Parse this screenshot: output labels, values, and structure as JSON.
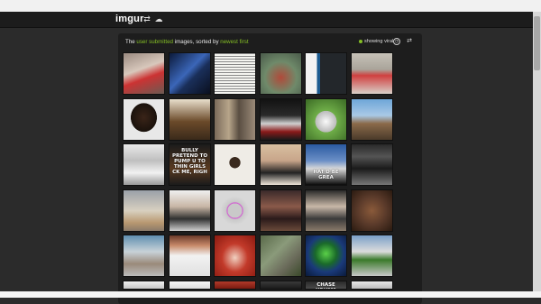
{
  "header": {
    "logo": "imgur",
    "random_icon": "shuffle-icon",
    "upload_icon": "cloud-upload-icon"
  },
  "gallery": {
    "caption_prefix": "The ",
    "caption_link1": "user submitted",
    "caption_middle": " images, sorted by ",
    "caption_link2": "newest first",
    "viral_label": "showing viral",
    "viral_dot_color": "#85bf25",
    "sort_icon": "clock-icon",
    "shuffle_icon": "shuffle-icon"
  },
  "tiles": [
    {
      "caption": "",
      "bg": "linear-gradient(160deg,#9a8a80,#d8c8bc 40%,#c33 60%,#6b5a52)"
    },
    {
      "caption": "",
      "bg": "linear-gradient(135deg,#0b1a3a,#3b66b8 45%,#1a2f5a 60%,#0a0f1e)"
    },
    {
      "caption": "",
      "bg": "repeating-linear-gradient(0deg,#f4f4f0 0,#f4f4f0 2px,#888 2px,#888 3px)"
    },
    {
      "caption": "",
      "bg": "radial-gradient(circle at 50% 60%,#b04a3a,#6f8a6a 50%,#4a5a4a)"
    },
    {
      "caption": "",
      "bg": "linear-gradient(90deg,#f2f2f2 0,#f2f2f2 28%,#1b5a8f 28%,#1b5a8f 36%,#23272b 36%)"
    },
    {
      "caption": "",
      "bg": "linear-gradient(180deg,#c7c2b8,#a9a49a 40%,#d04040 55%,#d8d0c8)"
    },
    {
      "caption": "",
      "bg": "radial-gradient(ellipse at 50% 45%,#3a2418,#1a120c 45%,#e8e8e8 46%)"
    },
    {
      "caption": "",
      "bg": "linear-gradient(180deg,#e9dfcc,#6b4a2a 55%,#3a2a1a)"
    },
    {
      "caption": "",
      "bg": "linear-gradient(90deg,#7a6a5a,#b7a58a 35%,#5a4e42 60%,#9a8a78)"
    },
    {
      "caption": "",
      "bg": "linear-gradient(180deg,#121212,#2a2a2a 40%,#d0d0d0 60%,#8a1a1a 80%,#1a1a1a)"
    },
    {
      "caption": "",
      "bg": "radial-gradient(circle at 50% 55%,#fafafa,#bbb 35%,#6fae48 36%,#3b6a25)"
    },
    {
      "caption": "",
      "bg": "linear-gradient(180deg,#6ea6d8,#a9c9e6 40%,#8b6a4a 60%,#4a3a2a)"
    },
    {
      "caption": "",
      "bg": "linear-gradient(180deg,#e9e9e9,#bfbfbf 40%,#f2f2f2 70%,#999)"
    },
    {
      "caption": "BULLY PRETEND TO PUMP U TO THIN GIRLS CK ME, RIGH",
      "bg": "linear-gradient(180deg,#1b1b1b,#5a3a20 60%,#1b1b1b)"
    },
    {
      "caption": "",
      "bg": "radial-gradient(circle at 50% 45%,#3a2a1e 0,#3a2a1e 18%,#efece6 19%)"
    },
    {
      "caption": "",
      "bg": "linear-gradient(180deg,#d8c0a0,#c8a58a 40%,#222 70%,#efe6da)"
    },
    {
      "caption": "HAT'D BE GREA",
      "bg": "linear-gradient(180deg,#2a5aa0,#6a8ec6 40%,#d8d8d8 60%,#0a0a0a)"
    },
    {
      "caption": "",
      "bg": "linear-gradient(180deg,#2a2a2a,#545454 30%,#1a1a1a 60%,#777)"
    },
    {
      "caption": "",
      "bg": "linear-gradient(180deg,#9aa0a8,#d8d0c0 50%,#b89870 80%,#8a7a6a)"
    },
    {
      "caption": "",
      "bg": "linear-gradient(180deg,#f0f0f0,#c8b6a6 40%,#303030 70%,#d0d0d0)"
    },
    {
      "caption": "",
      "bg": "radial-gradient(circle at 50% 50%,#c9c9c9 0,#c9c9c9 25%,#d34ad2 26%,#c9c9c9 31%,#d8d8d8 50%)"
    },
    {
      "caption": "",
      "bg": "linear-gradient(180deg,#3a2a2a,#8a5a4a 40%,#2a1a1a 70%,#6a4a3a)"
    },
    {
      "caption": "",
      "bg": "linear-gradient(180deg,#2a2a2a,#c8b8a8 40%,#3a3a3a 70%,#8a7a6a)"
    },
    {
      "caption": "",
      "bg": "radial-gradient(circle at 50% 50%,#8a5a3a,#5a3a2a 50%,#2a1a10)"
    },
    {
      "caption": "",
      "bg": "linear-gradient(180deg,#5f8fb0,#c8d2d8 40%,#9a8a7a 70%,#bbb)"
    },
    {
      "caption": "",
      "bg": "linear-gradient(180deg,#6a3a2a,#c88a6a 25%,#f2f2f2 50%,#e0e0e0)"
    },
    {
      "caption": "",
      "bg": "radial-gradient(ellipse at 50% 55%,#f0d0c0,#c23a2a 45%,#8a1a10)"
    },
    {
      "caption": "",
      "bg": "linear-gradient(135deg,#5a6a4a,#8a9a7a 40%,#6a6a5a 70%,#3a4a2a)"
    },
    {
      "caption": "",
      "bg": "radial-gradient(circle at 50% 45%,#5ad048,#1a6a2a 35%,#1a3a7a 60%,#0a1a3a)"
    },
    {
      "caption": "",
      "bg": "linear-gradient(180deg,#7aa0c8,#dcdcdc 40%,#3a7a2a 60%,#c8c8c8)"
    },
    {
      "caption": "",
      "bg": "linear-gradient(180deg,#f0f0f0,#c8c8c8)"
    },
    {
      "caption": "",
      "bg": "linear-gradient(180deg,#f6f6f6,#dcdcdc)"
    },
    {
      "caption": "",
      "bg": "linear-gradient(180deg,#b03a2a,#7a1a10)"
    },
    {
      "caption": "",
      "bg": "linear-gradient(180deg,#3a3a3a,#1a1a1a)"
    },
    {
      "caption": "CHASE YOU???",
      "bg": "linear-gradient(180deg,#2a2a2a,#4a4a4a)"
    },
    {
      "caption": "",
      "bg": "linear-gradient(180deg,#e8e8e8,#bcbcbc)"
    }
  ]
}
